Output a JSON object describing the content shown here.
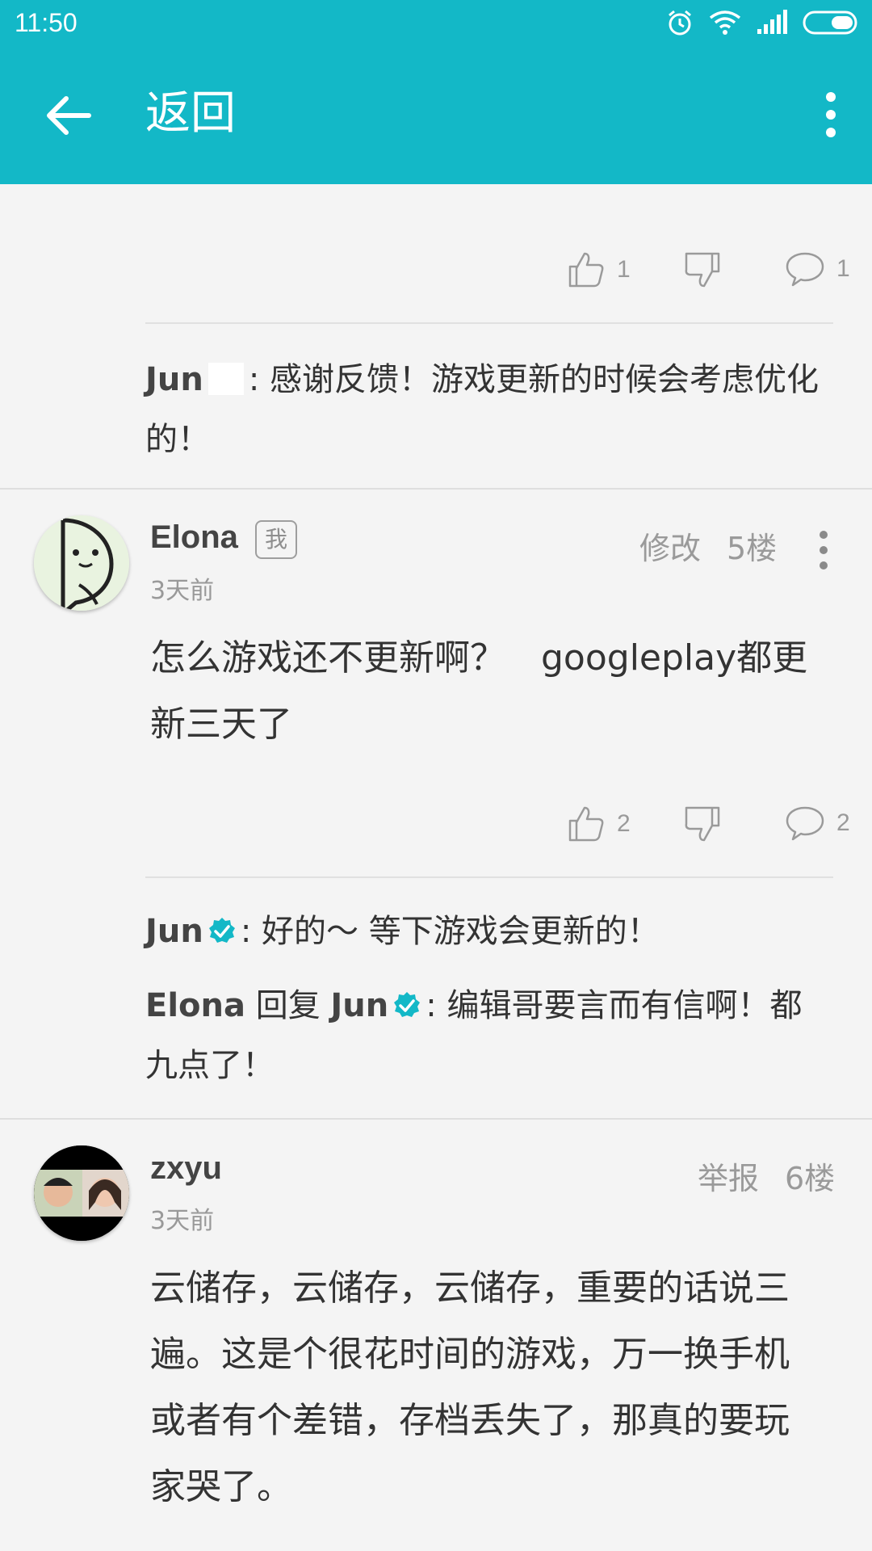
{
  "status_bar": {
    "time": "11:50",
    "icons": [
      "alarm-icon",
      "wifi-icon",
      "signal-icon",
      "battery-icon"
    ]
  },
  "header": {
    "back_icon": "arrow-left-icon",
    "title": "返回",
    "overflow_icon": "more-vert-icon"
  },
  "colors": {
    "accent": "#13b8c7",
    "verified": "#13b8c7",
    "background": "#f4f4f4"
  },
  "comments": [
    {
      "actions": {
        "likes": "1",
        "dislikes": "",
        "replies": "1"
      },
      "replies": [
        {
          "author": "Jun",
          "text": ": 感谢反馈！游戏更新的时候会考虑优化的！"
        }
      ]
    },
    {
      "author": "Elona",
      "me_badge": "我",
      "time": "3天前",
      "edit_label": "修改",
      "floor": "5楼",
      "text": "怎么游戏还不更新啊？　googleplay都更新三天了",
      "actions": {
        "likes": "2",
        "replies": "2"
      },
      "replies": [
        {
          "author": "Jun",
          "text": ": 好的～ 等下游戏会更新的！"
        },
        {
          "author": "Elona",
          "reply_word": "回复",
          "target": "Jun",
          "text": ": 编辑哥要言而有信啊！都九点了！"
        }
      ]
    },
    {
      "author": "zxyu",
      "time": "3天前",
      "report_label": "举报",
      "floor": "6楼",
      "text": "云储存，云储存，云储存，重要的话说三遍。这是个很花时间的游戏，万一换手机或者有个差错，存档丢失了，那真的要玩家哭了。"
    }
  ]
}
